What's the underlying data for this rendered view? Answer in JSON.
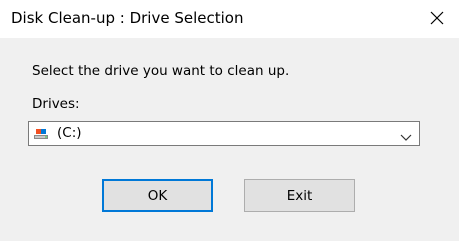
{
  "window": {
    "title": "Disk Clean-up : Drive Selection",
    "close_icon": "close-icon"
  },
  "content": {
    "prompt": "Select the drive you want to clean up.",
    "drives_label": "Drives:",
    "drive_select": {
      "selected_value": "(C:)",
      "icon": "drive-icon",
      "dropdown_icon": "chevron-down-icon"
    }
  },
  "buttons": {
    "ok_label": "OK",
    "exit_label": "Exit"
  },
  "colors": {
    "title_bg": "#ffffff",
    "body_bg": "#f0f0f0",
    "focus_border": "#0078d7",
    "button_bg": "#e1e1e1"
  }
}
